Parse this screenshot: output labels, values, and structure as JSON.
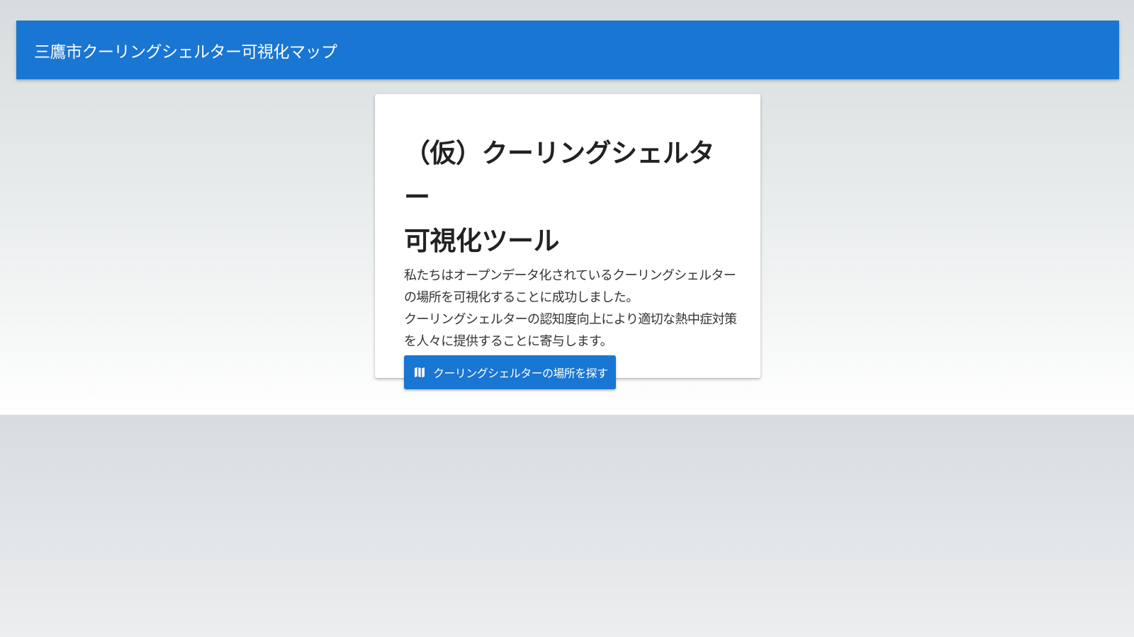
{
  "header": {
    "title": "三鷹市クーリングシェルター可視化マップ"
  },
  "hero": {
    "title_line1": "（仮）クーリングシェルター",
    "title_line2": "可視化ツール",
    "description_lines": [
      "私たちはオープンデータ化されているクーリングシェルター",
      "の場所を可視化することに成功しました。",
      "クーリングシェルターの認知度向上により適切な熱中症対策",
      "を人々に提供することに寄与します。"
    ],
    "button": {
      "label": "クーリングシェルターの場所を探す",
      "icon": "map-icon"
    }
  },
  "colors": {
    "primary": "#1976d2",
    "background": "#d7dcde",
    "card": "#ffffff",
    "text": "#222222"
  }
}
